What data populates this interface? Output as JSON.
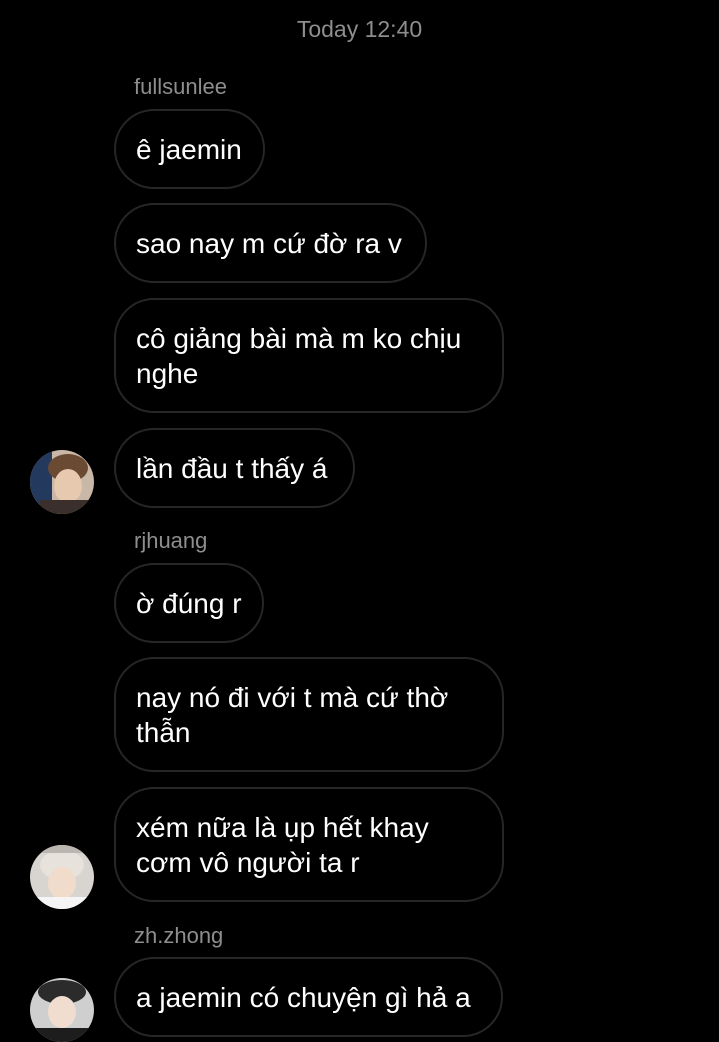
{
  "timestamp": "Today 12:40",
  "groups": [
    {
      "sender": "fullsunlee",
      "messages": [
        "ê jaemin",
        "sao nay m cứ đờ ra v",
        "cô giảng bài mà m ko chịu nghe",
        "lần đầu t thấy á"
      ],
      "avatar_icon": "user-avatar-fullsunlee"
    },
    {
      "sender": "rjhuang",
      "messages": [
        "ờ đúng r",
        "nay nó đi với t mà cứ thờ thẫn",
        "xém nữa là ụp hết khay cơm vô người ta r"
      ],
      "avatar_icon": "user-avatar-rjhuang"
    },
    {
      "sender": "zh.zhong",
      "messages": [
        "a jaemin có chuyện gì hả a"
      ],
      "avatar_icon": "user-avatar-zhzhong"
    }
  ],
  "colors": {
    "background": "#000000",
    "bubble_border": "#262626",
    "meta_text": "#8e8e8e",
    "message_text": "#ffffff"
  }
}
